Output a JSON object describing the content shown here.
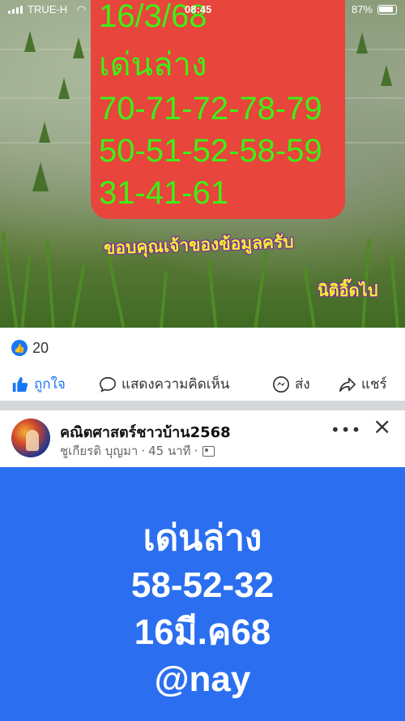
{
  "status_bar": {
    "carrier": "TRUE-H",
    "time": "08:45",
    "battery": "87%"
  },
  "post_image": {
    "red_card_lines": [
      "16/3/68",
      "เด่นล่าง",
      "70-71-72-78-79",
      "50-51-52-58-59",
      "31-41-61"
    ],
    "thanks_text": "ขอบคุณเจ้าของข้อมูลครับ",
    "author_text": "นิติอิ๊ดไป"
  },
  "reactions": {
    "count": "20"
  },
  "actions": {
    "like": "ถูกใจ",
    "comment": "แสดงความคิดเห็น",
    "send": "ส่ง",
    "share": "แชร์"
  },
  "next_post": {
    "page_name": "คณิตศาสตร์ชาวบ้าน2568",
    "author": "ชูเกียรติ บุญมา",
    "time": "45 นาที",
    "body_lines": [
      "เด่นล่าง",
      "58-52-32",
      "16มี.ค68",
      "@nay"
    ]
  },
  "colors": {
    "brand_blue": "#1877f2",
    "post_background": "#2b6ff0",
    "card_red": "#e8453c",
    "card_text_green": "#3df016"
  }
}
